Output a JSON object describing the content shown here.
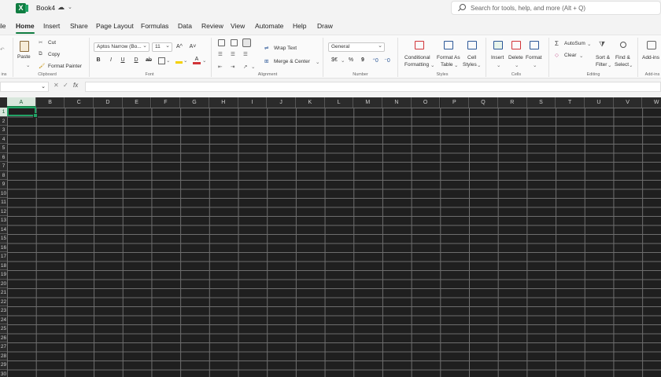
{
  "titlebar": {
    "doc_title": "Book4",
    "status_glyph": "☁",
    "chev": "⌄"
  },
  "search": {
    "placeholder": "Search for tools, help, and more (Alt + Q)"
  },
  "tabs": [
    "ile",
    "Home",
    "Insert",
    "Share",
    "Page Layout",
    "Formulas",
    "Data",
    "Review",
    "View",
    "Automate",
    "Help",
    "Draw"
  ],
  "active_tab": "Home",
  "ribbon": {
    "clipboard": {
      "paste": "Paste",
      "cut": "Cut",
      "copy": "Copy",
      "format_painter": "Format Painter",
      "label": "Clipboard"
    },
    "font": {
      "family": "Aptos Narrow (Bo...",
      "size": "11",
      "grow": "A^",
      "shrink": "A˅",
      "bold": "B",
      "italic": "I",
      "underline": "U",
      "double_underline": "D",
      "strike": "ab",
      "label": "Font"
    },
    "alignment": {
      "wrap": "Wrap Text",
      "merge": "Merge & Center",
      "label": "Alignment"
    },
    "number": {
      "format": "General",
      "currency": "$€",
      "percent": "%",
      "comma": "9",
      "inc": "⁺0",
      "dec": "⁻0",
      "label": "Number"
    },
    "styles": {
      "conditional": "Conditional",
      "conditional2": "Formatting",
      "format_as": "Format As",
      "format_as2": "Table",
      "cell": "Cell",
      "cell2": "Styles",
      "label": "Styles"
    },
    "cells": {
      "insert": "Insert",
      "delete": "Delete",
      "format": "Format",
      "label": "Cells"
    },
    "editing": {
      "autosum": "AutoSum",
      "clear": "Clear",
      "sort": "Sort &",
      "sort2": "Filter",
      "find": "Find &",
      "find2": "Select",
      "label": "Editing"
    },
    "addins": {
      "name": "Add-ins",
      "label": "Add-ins"
    },
    "edge_label": "ins"
  },
  "formula_bar": {
    "fx": "fx",
    "cancel": "✕",
    "enter": "✓"
  },
  "grid": {
    "columns": [
      "A",
      "B",
      "C",
      "D",
      "E",
      "F",
      "G",
      "H",
      "I",
      "J",
      "K",
      "L",
      "M",
      "N",
      "O",
      "P",
      "Q",
      "R",
      "S",
      "T",
      "U",
      "V",
      "W"
    ],
    "rows": [
      "1",
      "2",
      "3",
      "4",
      "5",
      "6",
      "7",
      "8",
      "9",
      "10",
      "11",
      "12",
      "13",
      "14",
      "15",
      "16",
      "17",
      "18",
      "19",
      "20",
      "21",
      "22",
      "23",
      "24",
      "25",
      "26",
      "27",
      "28",
      "29",
      "30"
    ],
    "selected_column": "A",
    "selected_row": "1"
  },
  "colors": {
    "accent": "#107c41",
    "grid_bg": "#1f1f1f",
    "gridline": "#6e6e6e"
  }
}
